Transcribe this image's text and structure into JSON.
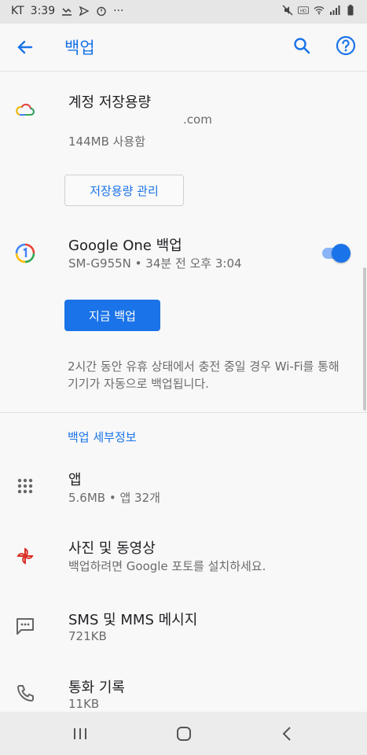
{
  "status_bar": {
    "carrier": "KT",
    "time": "3:39",
    "left_icons": [
      "missed-call-icon",
      "send-icon",
      "timer-icon",
      "more-dots-icon"
    ],
    "right_icons": [
      "mute-icon",
      "hd-icon",
      "wifi-icon",
      "signal-icon",
      "battery-icon"
    ],
    "more": "···"
  },
  "app_bar": {
    "title": "백업",
    "back_icon": "arrow-back-icon",
    "search_icon": "search-icon",
    "help_icon": "help-icon",
    "accent": "#1a73e8"
  },
  "account_storage": {
    "title": "계정 저장용량",
    "email": ".com",
    "usage": "144MB 사용함",
    "manage_button": "저장용량 관리",
    "icon": "cloud-icon"
  },
  "google_one_backup": {
    "title": "Google One 백업",
    "subtitle": "SM-G955N • 34분 전 오후 3:04",
    "toggle_on": true,
    "backup_now_button": "지금 백업",
    "note": "2시간 동안 유휴 상태에서 충전 중일 경우 Wi-Fi를 통해 기기가 자동으로 백업됩니다.",
    "icon": "google-one-icon"
  },
  "details": {
    "section_title": "백업 세부정보",
    "items": [
      {
        "title": "앱",
        "subtitle": "5.6MB • 앱 32개",
        "icon": "apps-grid-icon"
      },
      {
        "title": "사진 및 동영상",
        "subtitle": "백업하려면 Google 포토를 설치하세요.",
        "icon": "pinwheel-icon"
      },
      {
        "title": "SMS 및 MMS 메시지",
        "subtitle": "721KB",
        "icon": "message-icon"
      },
      {
        "title": "통화 기록",
        "subtitle": "11KB",
        "icon": "phone-icon"
      }
    ]
  },
  "nav_bar": {
    "recent_icon": "recent-apps-icon",
    "home_icon": "home-icon",
    "back_icon": "back-chevron-icon"
  }
}
